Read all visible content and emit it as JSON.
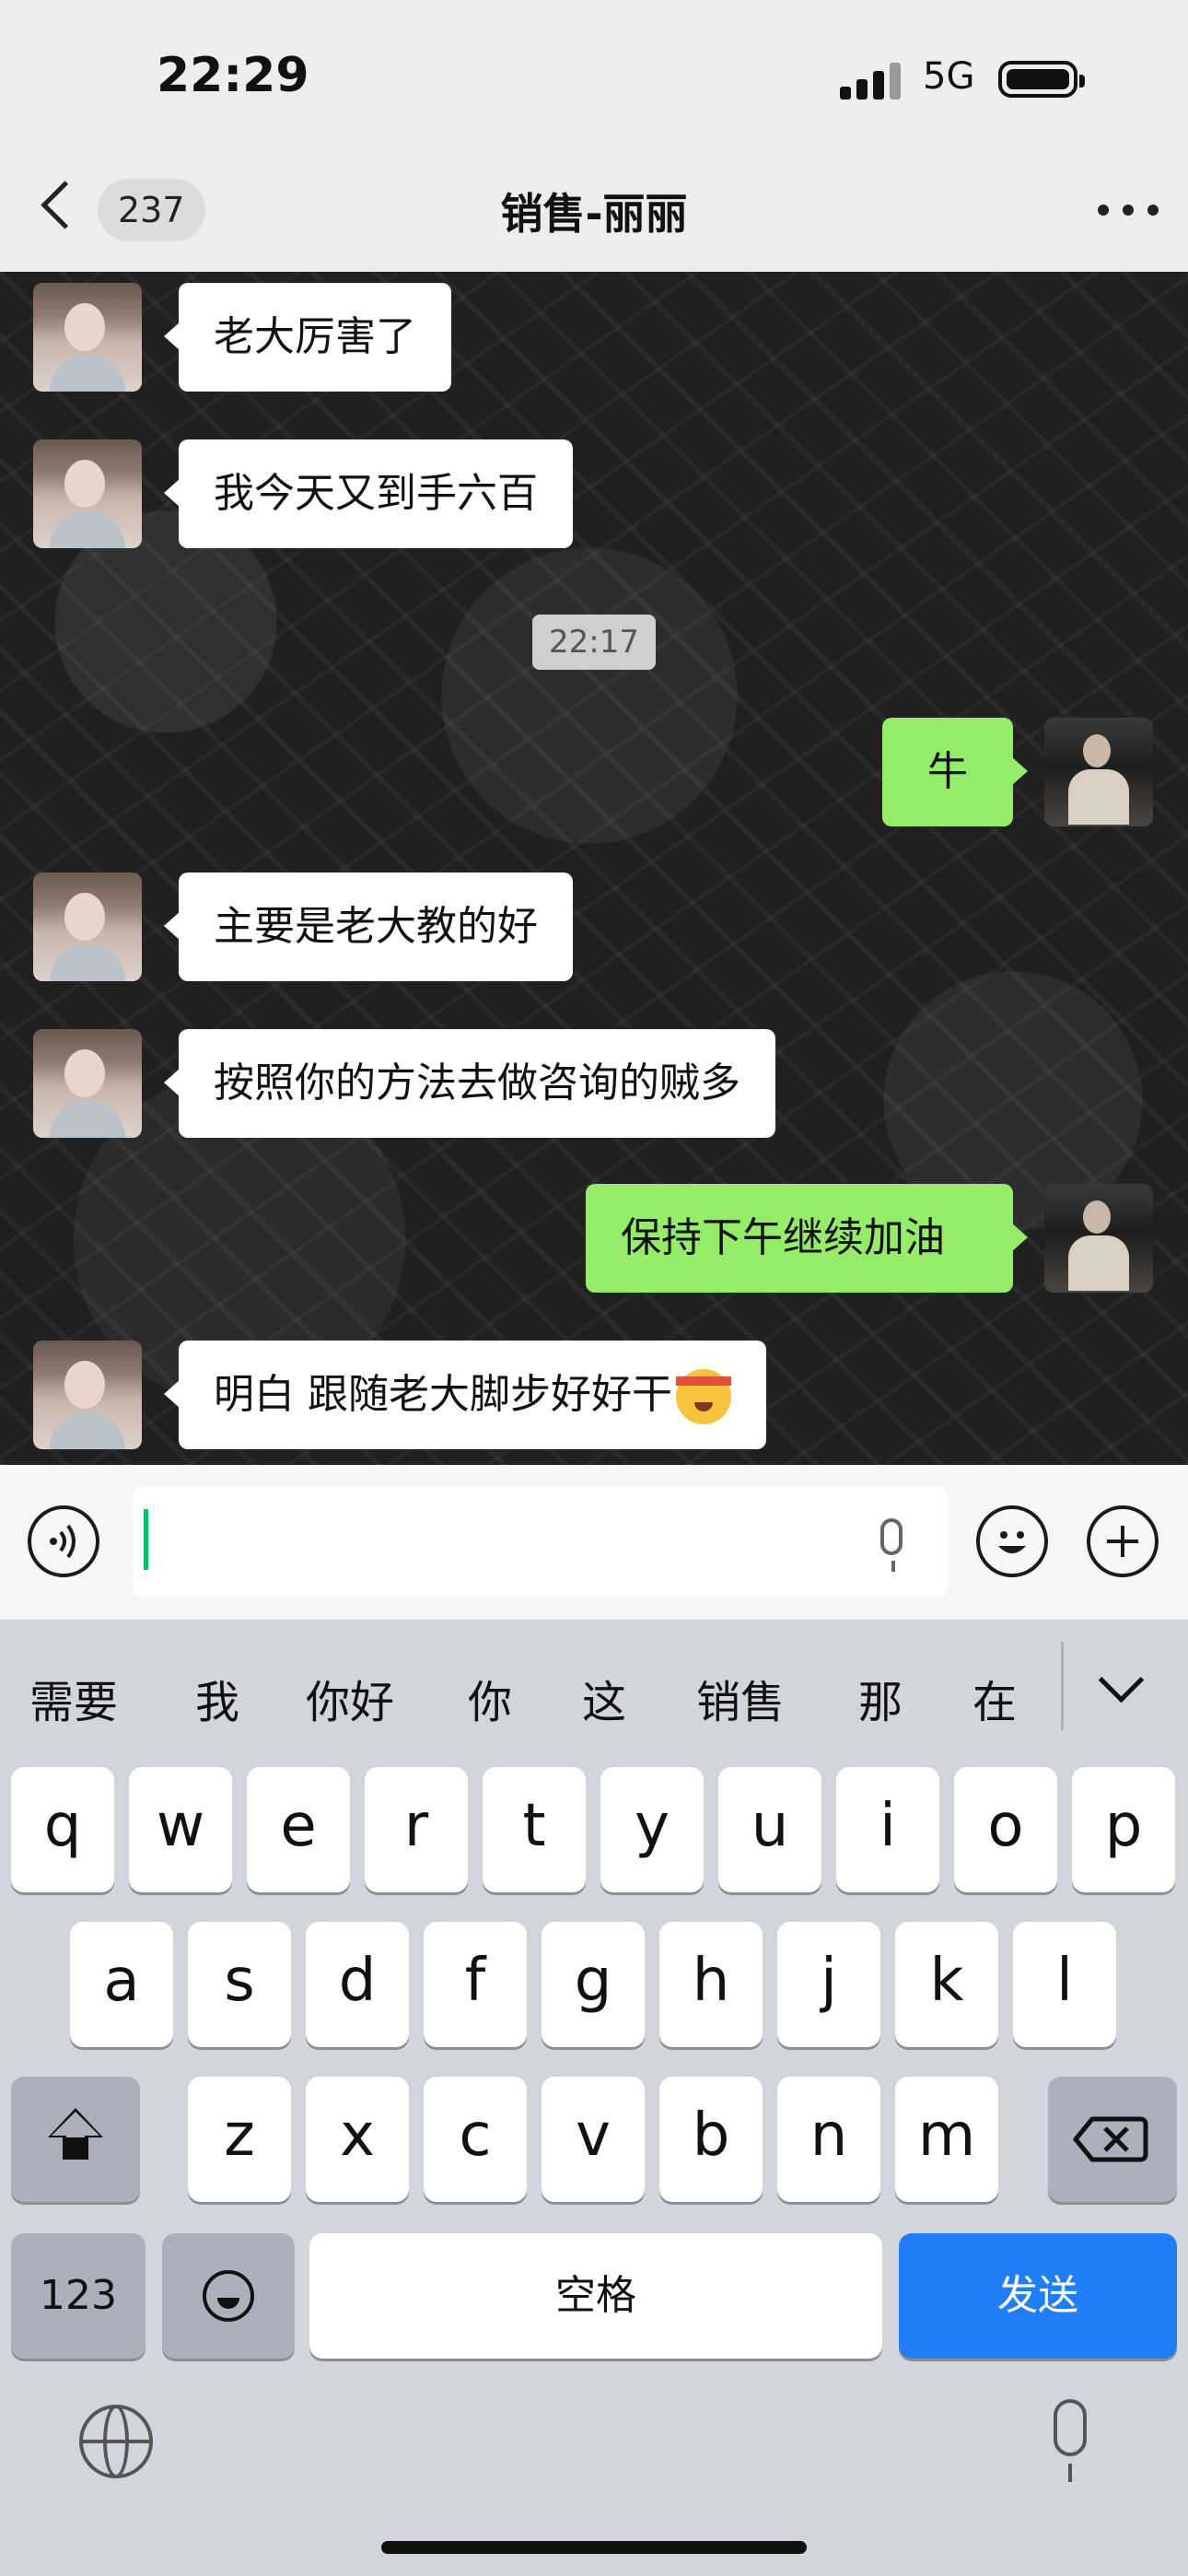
{
  "status_bar": {
    "time": "22:29",
    "network": "5G"
  },
  "nav": {
    "unread_count": "237",
    "title": "销售-丽丽"
  },
  "chat": {
    "messages": [
      {
        "side": "in",
        "text": "老大厉害了"
      },
      {
        "side": "in",
        "text": "我今天又到手六百"
      },
      {
        "side": "time",
        "text": "22:17"
      },
      {
        "side": "out",
        "text": "牛"
      },
      {
        "side": "in",
        "text": "主要是老大教的好"
      },
      {
        "side": "in",
        "text": "按照你的方法去做咨询的贼多"
      },
      {
        "side": "out",
        "text": "保持下午继续加油"
      },
      {
        "side": "in",
        "text": "明白 跟随老大脚步好好干",
        "emoji": "salute-face-emoji"
      }
    ]
  },
  "input": {
    "value": ""
  },
  "keyboard": {
    "suggestions": [
      "需要",
      "我",
      "你好",
      "你",
      "这",
      "销售",
      "那",
      "在"
    ],
    "row1": [
      "q",
      "w",
      "e",
      "r",
      "t",
      "y",
      "u",
      "i",
      "o",
      "p"
    ],
    "row2": [
      "a",
      "s",
      "d",
      "f",
      "g",
      "h",
      "j",
      "k",
      "l"
    ],
    "row3": [
      "z",
      "x",
      "c",
      "v",
      "b",
      "n",
      "m"
    ],
    "numbers_label": "123",
    "space_label": "空格",
    "send_label": "发送"
  },
  "colors": {
    "outgoing_bubble": "#95ec69",
    "send_key": "#1f7ef8",
    "cursor": "#07c160"
  }
}
